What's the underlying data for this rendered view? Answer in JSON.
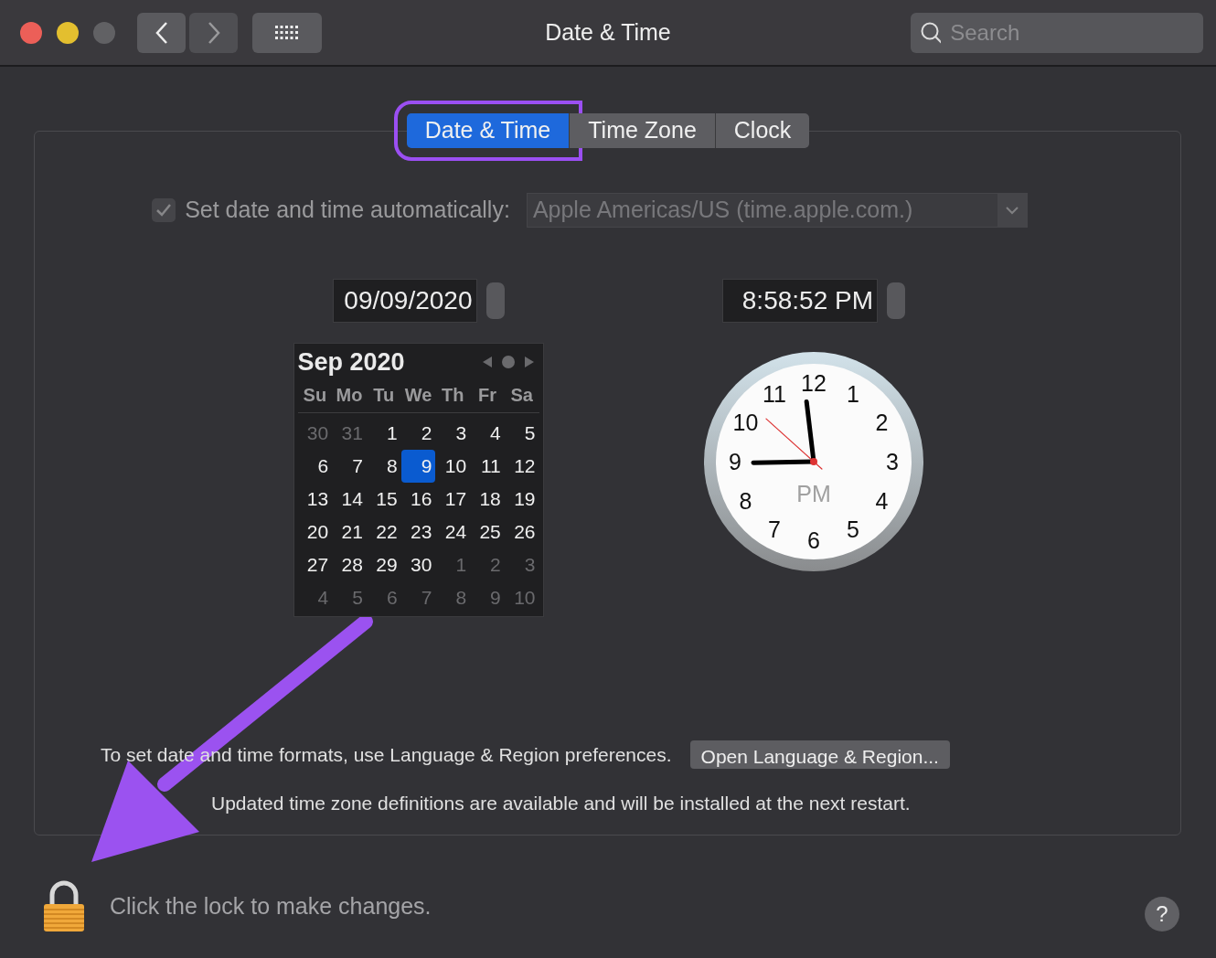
{
  "window": {
    "title": "Date & Time",
    "search": {
      "placeholder": "Search"
    }
  },
  "tabs": [
    {
      "label": "Date & Time",
      "selected": true
    },
    {
      "label": "Time Zone",
      "selected": false
    },
    {
      "label": "Clock",
      "selected": false
    }
  ],
  "auto_time": {
    "label": "Set date and time automatically:",
    "checked": true,
    "disabled": true,
    "server": "Apple Americas/US (time.apple.com.)"
  },
  "date_field": {
    "value": "09/09/2020"
  },
  "time_field": {
    "value": "8:58:52 PM"
  },
  "calendar": {
    "title": "Sep 2020",
    "weekdays": [
      "Su",
      "Mo",
      "Tu",
      "We",
      "Th",
      "Fr",
      "Sa"
    ],
    "weeks": [
      [
        {
          "day": "30",
          "muted": true,
          "selected": false
        },
        {
          "day": "31",
          "muted": true,
          "selected": false
        },
        {
          "day": "1",
          "muted": false,
          "selected": false
        },
        {
          "day": "2",
          "muted": false,
          "selected": false
        },
        {
          "day": "3",
          "muted": false,
          "selected": false
        },
        {
          "day": "4",
          "muted": false,
          "selected": false
        },
        {
          "day": "5",
          "muted": false,
          "selected": false
        }
      ],
      [
        {
          "day": "6",
          "muted": false,
          "selected": false
        },
        {
          "day": "7",
          "muted": false,
          "selected": false
        },
        {
          "day": "8",
          "muted": false,
          "selected": false
        },
        {
          "day": "9",
          "muted": false,
          "selected": true
        },
        {
          "day": "10",
          "muted": false,
          "selected": false
        },
        {
          "day": "11",
          "muted": false,
          "selected": false
        },
        {
          "day": "12",
          "muted": false,
          "selected": false
        }
      ],
      [
        {
          "day": "13",
          "muted": false,
          "selected": false
        },
        {
          "day": "14",
          "muted": false,
          "selected": false
        },
        {
          "day": "15",
          "muted": false,
          "selected": false
        },
        {
          "day": "16",
          "muted": false,
          "selected": false
        },
        {
          "day": "17",
          "muted": false,
          "selected": false
        },
        {
          "day": "18",
          "muted": false,
          "selected": false
        },
        {
          "day": "19",
          "muted": false,
          "selected": false
        }
      ],
      [
        {
          "day": "20",
          "muted": false,
          "selected": false
        },
        {
          "day": "21",
          "muted": false,
          "selected": false
        },
        {
          "day": "22",
          "muted": false,
          "selected": false
        },
        {
          "day": "23",
          "muted": false,
          "selected": false
        },
        {
          "day": "24",
          "muted": false,
          "selected": false
        },
        {
          "day": "25",
          "muted": false,
          "selected": false
        },
        {
          "day": "26",
          "muted": false,
          "selected": false
        }
      ],
      [
        {
          "day": "27",
          "muted": false,
          "selected": false
        },
        {
          "day": "28",
          "muted": false,
          "selected": false
        },
        {
          "day": "29",
          "muted": false,
          "selected": false
        },
        {
          "day": "30",
          "muted": false,
          "selected": false
        },
        {
          "day": "1",
          "muted": true,
          "selected": false
        },
        {
          "day": "2",
          "muted": true,
          "selected": false
        },
        {
          "day": "3",
          "muted": true,
          "selected": false
        }
      ],
      [
        {
          "day": "4",
          "muted": true,
          "selected": false
        },
        {
          "day": "5",
          "muted": true,
          "selected": false
        },
        {
          "day": "6",
          "muted": true,
          "selected": false
        },
        {
          "day": "7",
          "muted": true,
          "selected": false
        },
        {
          "day": "8",
          "muted": true,
          "selected": false
        },
        {
          "day": "9",
          "muted": true,
          "selected": false
        },
        {
          "day": "10",
          "muted": true,
          "selected": false
        }
      ]
    ]
  },
  "clock": {
    "numerals": [
      "12",
      "11",
      "1",
      "10",
      "2",
      "9",
      "3",
      "8",
      "4",
      "7",
      "5",
      "6"
    ],
    "period": "PM"
  },
  "formats": {
    "text": "To set date and time formats, use Language & Region preferences.",
    "button": "Open Language & Region..."
  },
  "update_note": "Updated time zone definitions are available and will be installed at the next restart.",
  "lock": {
    "text": "Click the lock to make changes."
  },
  "help": "?"
}
